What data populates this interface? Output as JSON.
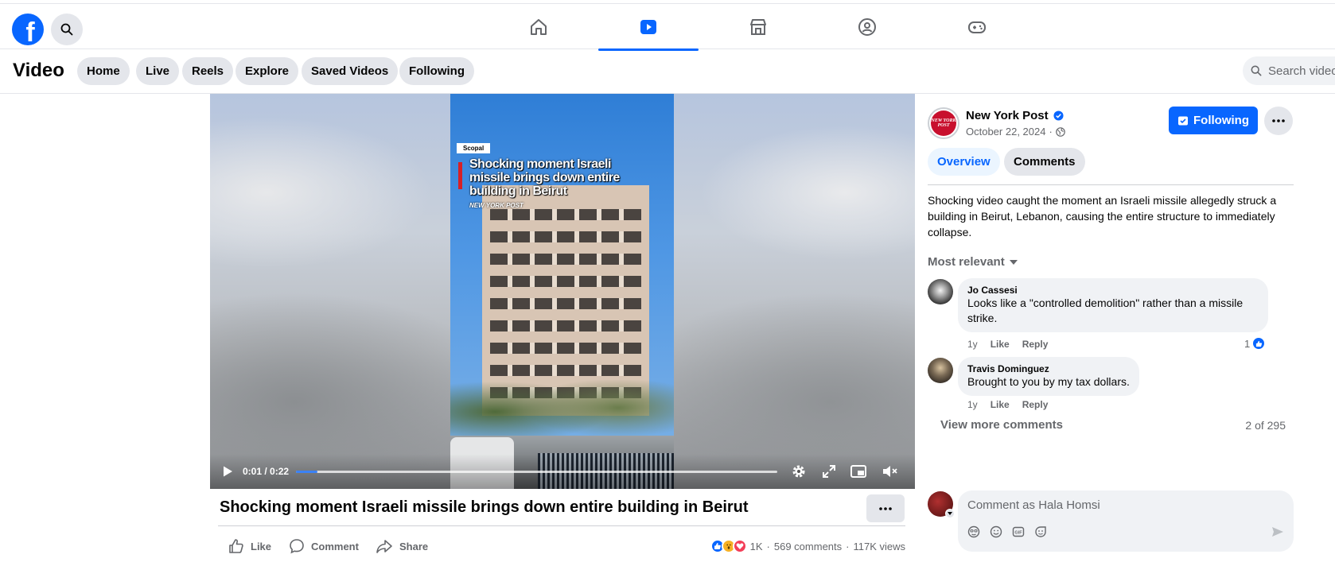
{
  "topnav": {
    "logo_letter": "f",
    "tabs": [
      "home",
      "video",
      "marketplace",
      "groups",
      "gaming"
    ],
    "active_tab": "video"
  },
  "subheader": {
    "title": "Video",
    "pills": [
      "Home",
      "Live",
      "Reels",
      "Explore",
      "Saved Videos",
      "Following"
    ],
    "search_placeholder": "Search videos"
  },
  "video": {
    "overlay_badge": "Scopal",
    "overlay_headline": "Shocking moment Israeli missile brings down entire building in Beirut",
    "overlay_source": "NEW YORK POST",
    "time": "0:01 / 0:22",
    "progress": 0.045,
    "title": "Shocking moment Israeli missile brings down entire building in Beirut"
  },
  "actions": {
    "like": "Like",
    "comment": "Comment",
    "share": "Share"
  },
  "stats": {
    "reactions": "1K",
    "comments": "569 comments",
    "views": "117K views"
  },
  "post": {
    "page_name": "New York Post",
    "avatar_text": "NEW YORK POST",
    "date": "October 22, 2024",
    "following_label": "Following",
    "tabs": {
      "overview": "Overview",
      "comments": "Comments"
    },
    "description": "Shocking video caught the moment an Israeli missile allegedly struck a building in Beirut, Lebanon, causing the entire structure to immediately collapse.",
    "sort_label": "Most relevant"
  },
  "comments": [
    {
      "author": "Jo Cassesi",
      "text": "Looks like a \"controlled demolition\" rather than a missile strike.",
      "time": "1y",
      "like": "Like",
      "reply": "Reply",
      "likes": "1"
    },
    {
      "author": "Travis Dominguez",
      "text": "Brought to you by my tax dollars.",
      "time": "1y",
      "like": "Like",
      "reply": "Reply"
    }
  ],
  "comments_footer": {
    "view_more": "View more comments",
    "count": "2 of 295"
  },
  "composer": {
    "placeholder": "Comment as Hala Homsi"
  },
  "colors": {
    "brand": "#0866ff",
    "pill_bg": "#e4e6eb",
    "secondary_text": "#65676b"
  }
}
